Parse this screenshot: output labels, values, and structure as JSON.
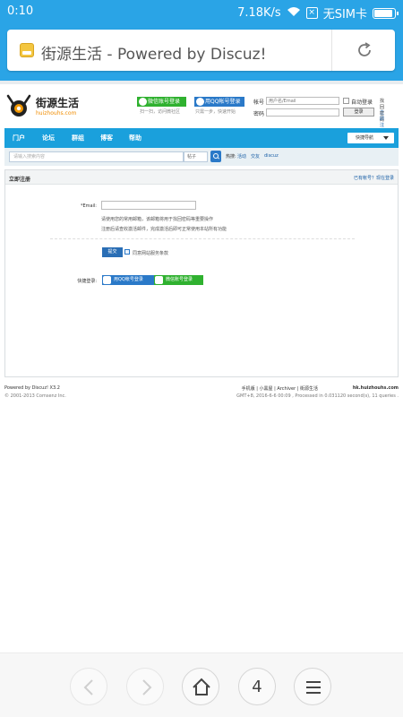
{
  "status_bar": {
    "time": "0:10",
    "speed": "7.18K/s",
    "sim_text": "无SIM卡",
    "battery_level": 0.9
  },
  "browser": {
    "tab_title": "街源生活 - Powered by Discuz!",
    "tabs_count": "4",
    "colors": {
      "chrome": "#2aa4e6",
      "nav": "#1aa0dc"
    }
  },
  "site": {
    "logo_name": "街源生活",
    "logo_domain": "huizhouhs.com"
  },
  "header": {
    "wechat_login": "微信账号登录",
    "wechat_hint": "扫一扫，访问微社区",
    "qq_login": "用QQ帐号登录",
    "qq_hint": "只需一步，快速开始",
    "login": {
      "account_label": "帐号",
      "account_placeholder": "用户名/Email",
      "password_label": "密码",
      "auto_login": "自动登录",
      "login_button": "登录",
      "find_password": "找回密码",
      "register": "立即注册"
    }
  },
  "nav": {
    "items": [
      "门户",
      "论坛",
      "群组",
      "博客",
      "帮助"
    ],
    "quick_nav": "快捷导航"
  },
  "search": {
    "placeholder": "请输入搜索内容",
    "type": "帖子",
    "hot_label": "热搜:",
    "hot_items": [
      "活动",
      "交友",
      "discuz"
    ]
  },
  "register": {
    "title": "立即注册",
    "have_account": "已有帐号？现在登录",
    "email_label": "*Email:",
    "note1": "请使用您的常用邮箱，该邮箱将用于找回密码等重要操作",
    "note2": "注册后请查收激活邮件，完成激活后即可正常使用本站所有功能",
    "submit": "提交",
    "agree_text": "同意网站服务条款",
    "quick_login_label": "快捷登录:",
    "qq_login": "用QQ帐号登录",
    "wechat_login": "微信账号登录"
  },
  "footer": {
    "powered": "Powered by Discuz! X3.2",
    "copyright": "© 2001-2013 Comsenz Inc.",
    "links": "手机版 | 小黑屋 | Archiver | 街源生活",
    "domain": "hk.huizhouhs.com",
    "stats": "GMT+8, 2016-6-6 00:09 , Processed in 0.031120 second(s), 11 queries ."
  }
}
